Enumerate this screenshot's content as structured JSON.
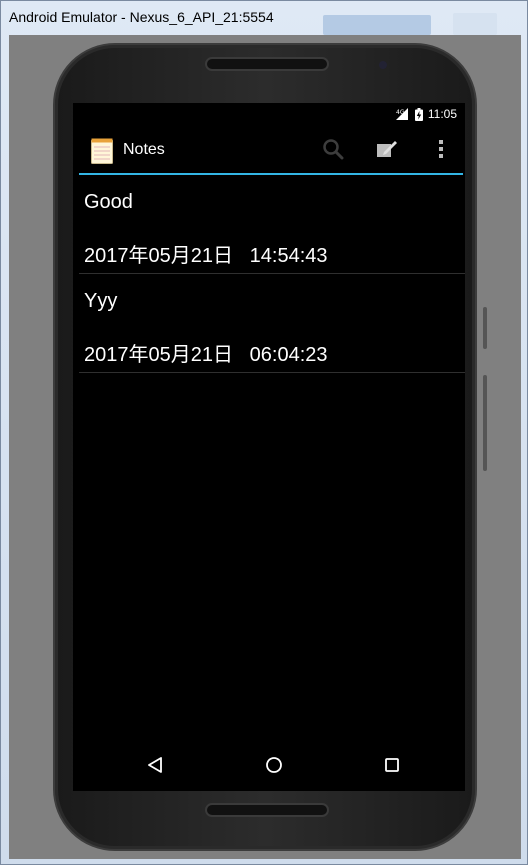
{
  "window": {
    "title": "Android Emulator - Nexus_6_API_21:5554"
  },
  "status_bar": {
    "network": "4G",
    "time": "11:05"
  },
  "action_bar": {
    "title": "Notes",
    "icons": [
      "notepad-icon",
      "search-icon",
      "new-note-icon",
      "overflow-menu-icon"
    ]
  },
  "notes": [
    {
      "title": "Good",
      "date": "2017年05月21日   14:54:43"
    },
    {
      "title": "Yyy",
      "date": "2017年05月21日   06:04:23"
    }
  ],
  "nav_bar": {
    "icons": [
      "back-icon",
      "home-icon",
      "recents-icon"
    ]
  },
  "colors": {
    "accent": "#33b5e5",
    "screen_bg": "#000000",
    "frame": "#808080"
  }
}
